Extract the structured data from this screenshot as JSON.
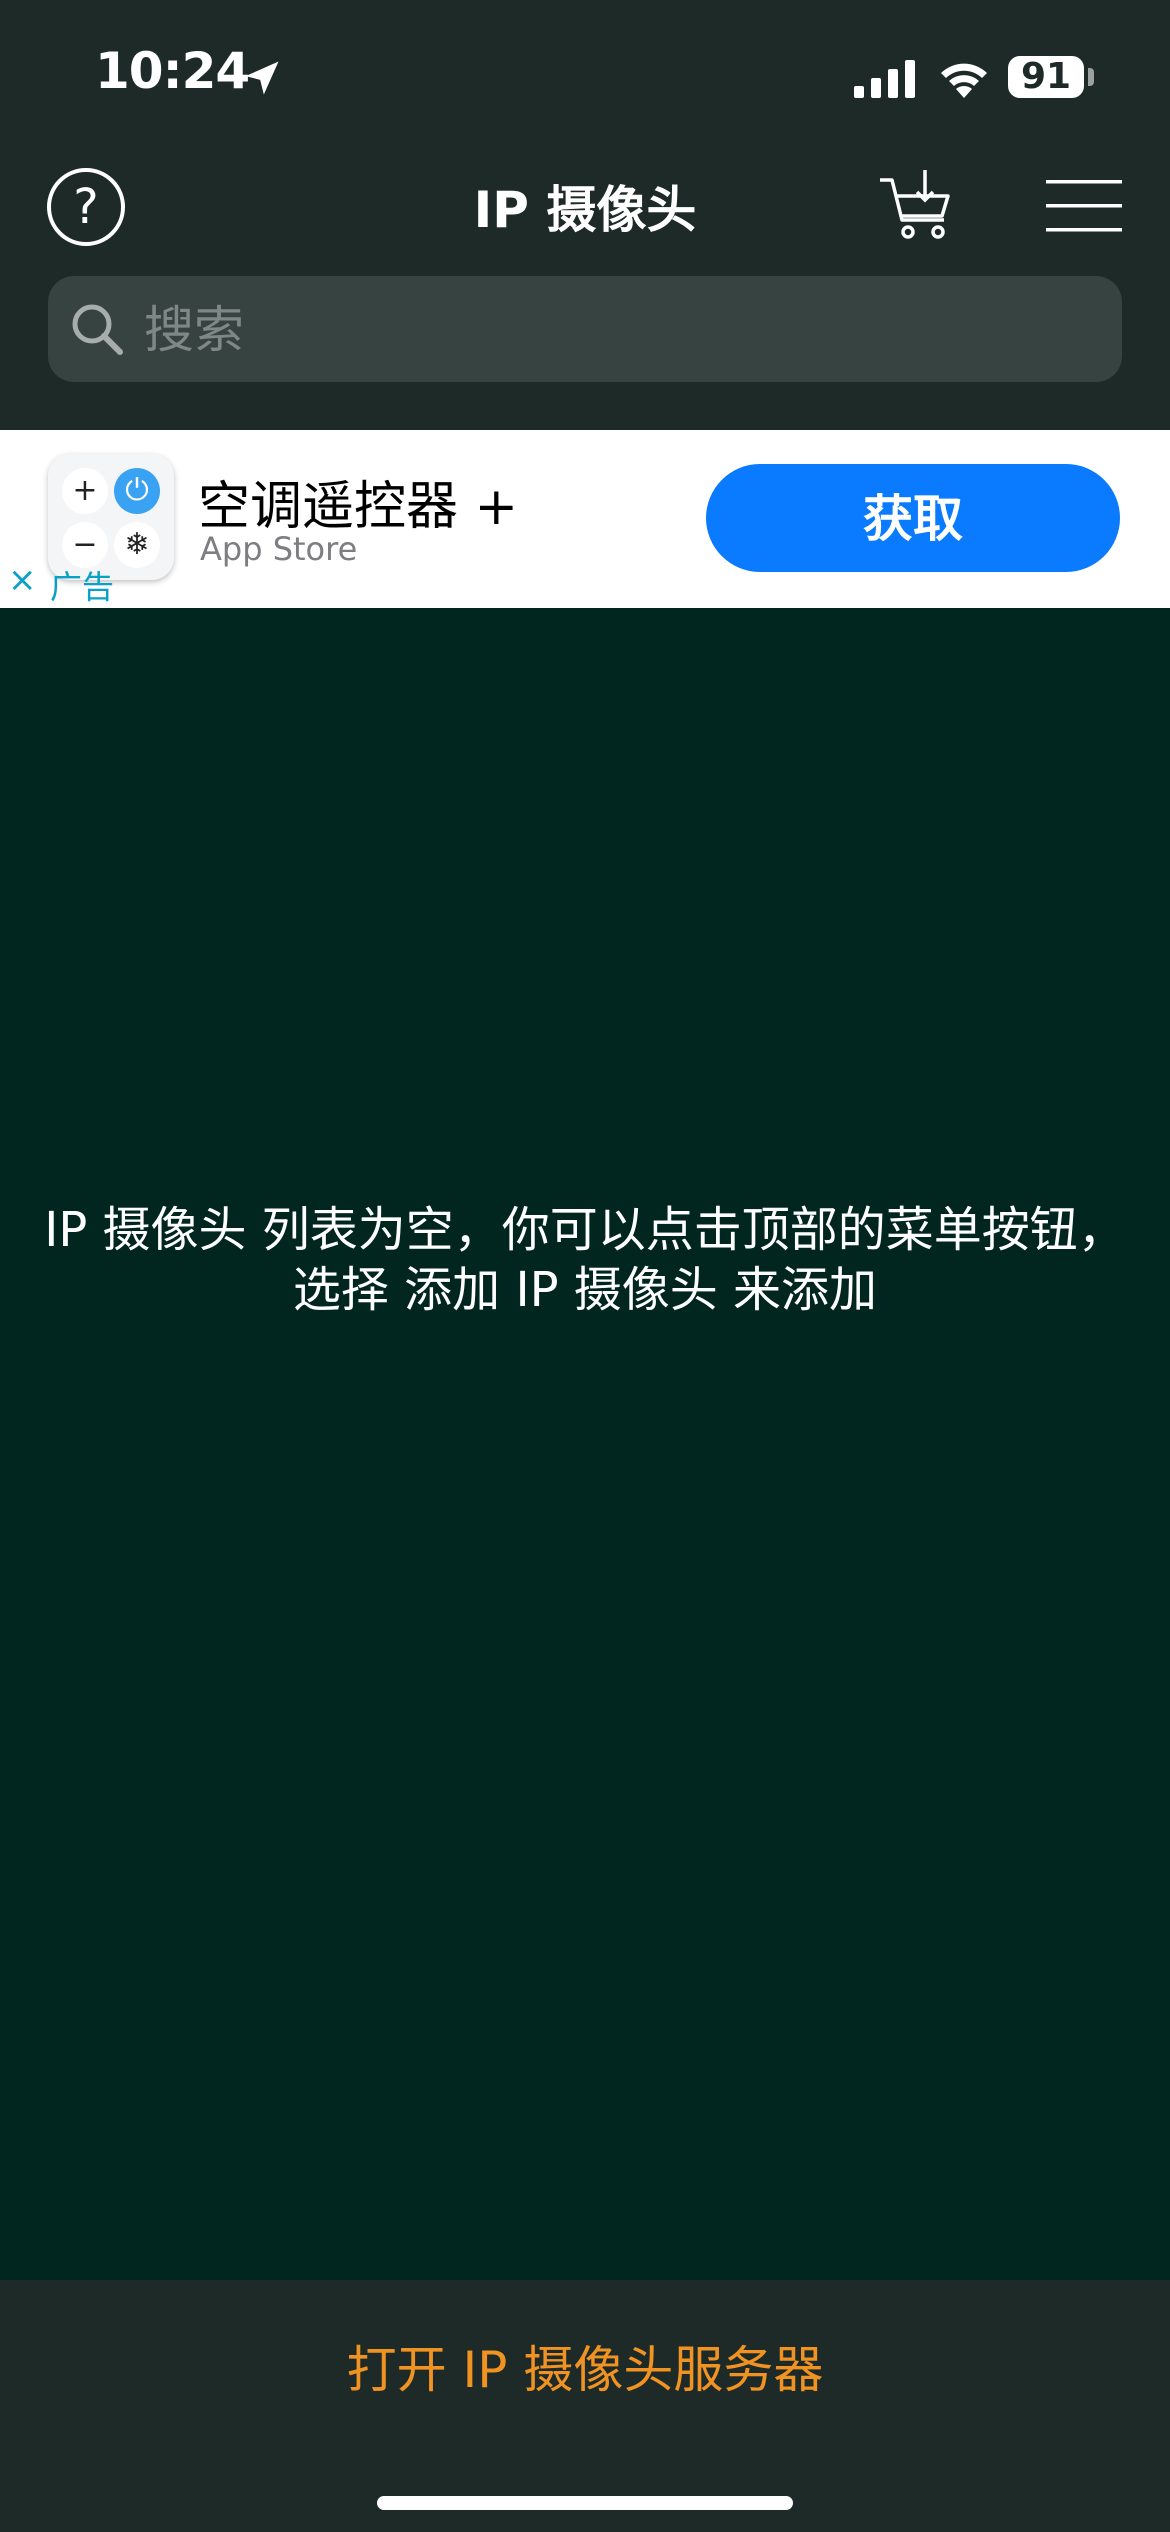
{
  "status_bar": {
    "time": "10:24",
    "battery": "91"
  },
  "nav": {
    "help_label": "?",
    "title": "IP 摄像头"
  },
  "search": {
    "placeholder": "搜索"
  },
  "ad": {
    "title": "空调遥控器 +",
    "subtitle": "App Store",
    "get_label": "获取",
    "close_label": "×",
    "ad_label": "广告",
    "icon_keys": [
      "+",
      "⏻",
      "−",
      "❄"
    ]
  },
  "main": {
    "empty_line1": "IP 摄像头 列表为空，你可以点击顶部的菜单按钮，",
    "empty_line2": "选择 添加 IP 摄像头 来添加"
  },
  "bottom": {
    "server_button": "打开 IP 摄像头服务器"
  },
  "colors": {
    "header_bg": "#1e2a28",
    "main_bg": "#012620",
    "accent_orange": "#f09322",
    "ad_button_blue": "#0a7aff"
  }
}
